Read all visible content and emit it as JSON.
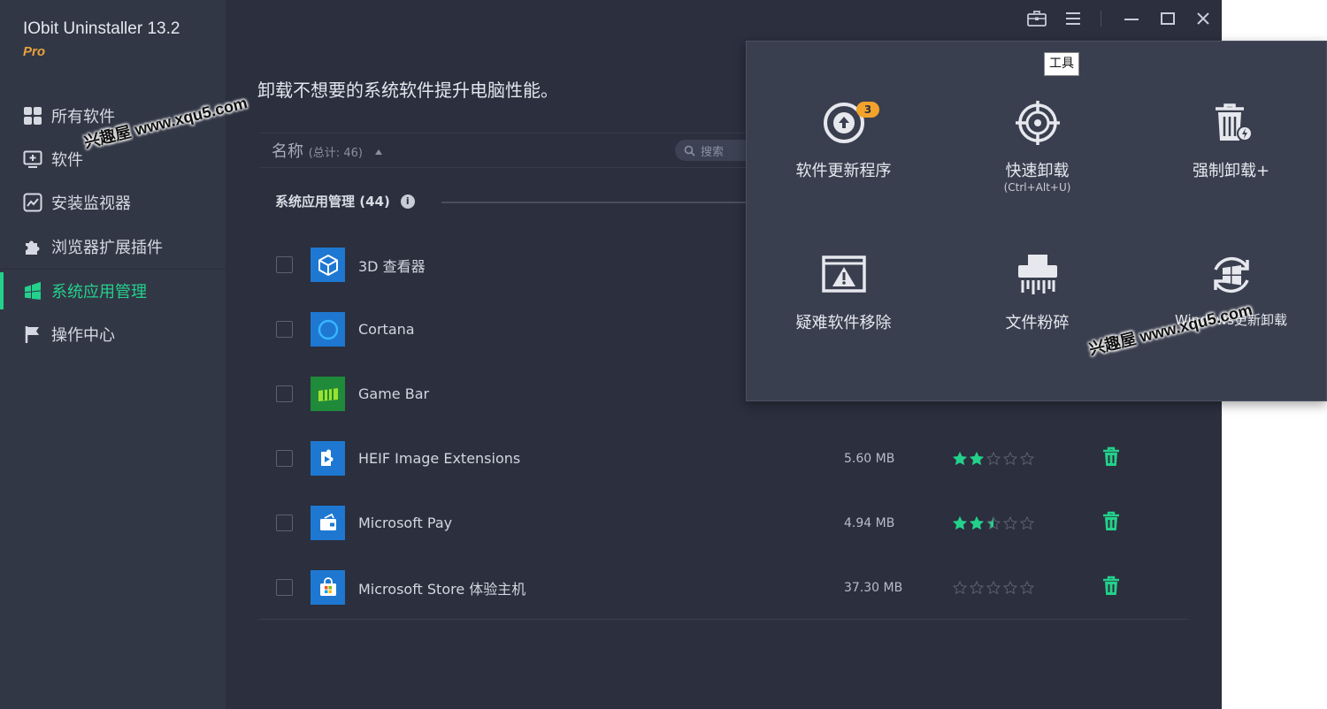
{
  "app": {
    "title": "IObit Uninstaller 13.2",
    "edition": "Pro"
  },
  "sidebar": {
    "items": [
      {
        "label": "所有软件",
        "icon": "grid-icon"
      },
      {
        "label": "软件",
        "icon": "monitor-plus-icon"
      },
      {
        "label": "安装监视器",
        "icon": "chart-line-icon"
      },
      {
        "label": "浏览器扩展插件",
        "icon": "puzzle-icon"
      },
      {
        "label": "系统应用管理",
        "icon": "windows-logo-icon",
        "active": true
      },
      {
        "label": "操作中心",
        "icon": "flag-icon"
      }
    ]
  },
  "main": {
    "subtitle": "卸载不想要的系统软件提升电脑性能。",
    "column_name": "名称",
    "column_count": "(总计: 46)",
    "search_placeholder": "搜索",
    "group_title": "系统应用管理 (44)",
    "group_info": "i",
    "rows": [
      {
        "name": "3D 查看器",
        "size": "",
        "rating": null,
        "icon": "cube-icon"
      },
      {
        "name": "Cortana",
        "size": "",
        "rating": null,
        "icon": "circle-icon"
      },
      {
        "name": "Game Bar",
        "size": "",
        "rating": null,
        "icon": "gamebar-icon"
      },
      {
        "name": "HEIF Image Extensions",
        "size": "5.60 MB",
        "rating": 2,
        "icon": "puzzle-play-icon"
      },
      {
        "name": "Microsoft Pay",
        "size": "4.94 MB",
        "rating": 2.5,
        "icon": "wallet-icon"
      },
      {
        "name": "Microsoft Store 体验主机",
        "size": "37.30 MB",
        "rating": 0,
        "icon": "store-icon"
      }
    ]
  },
  "tools_popup": {
    "tooltip": "工具",
    "items": [
      {
        "label": "软件更新程序",
        "sub": "",
        "badge": "3",
        "icon": "upload-circle-icon"
      },
      {
        "label": "快速卸载",
        "sub": "(Ctrl+Alt+U)",
        "icon": "crosshair-icon"
      },
      {
        "label": "强制卸载+",
        "sub": "",
        "icon": "trash-bolt-icon"
      },
      {
        "label": "疑难软件移除",
        "sub": "",
        "icon": "warning-window-icon"
      },
      {
        "label": "文件粉碎",
        "sub": "",
        "icon": "shredder-icon"
      },
      {
        "label": "Windows更新卸载",
        "sub": "",
        "icon": "windows-refresh-icon"
      }
    ]
  },
  "watermarks": [
    "兴趣屋 www.xqu5.com",
    "兴趣屋 www.xqu5.com"
  ],
  "colors": {
    "accent": "#23d18b",
    "background": "#2b2f3e",
    "sidebar": "#323746",
    "popup": "#3a3f4f",
    "badge": "#f2a32b",
    "brand_pro": "#e8a33b"
  }
}
